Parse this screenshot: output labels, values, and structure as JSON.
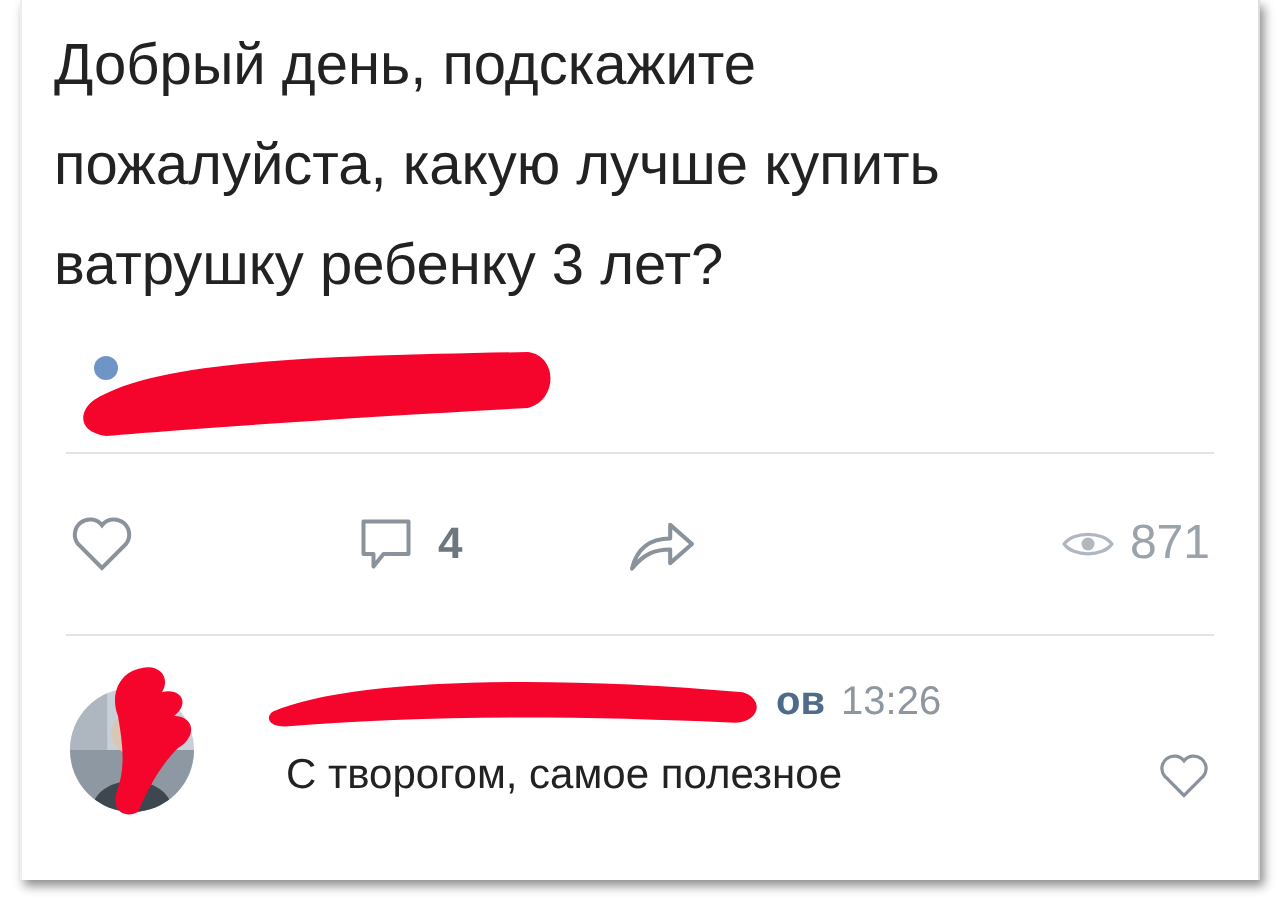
{
  "post": {
    "text": "Добрый день, подскажите пожалуйста, какую лучше купить ватрушку ребенку 3 лет?"
  },
  "actions": {
    "like": {
      "liked": false
    },
    "comments": "4",
    "views": "871"
  },
  "comment": {
    "author": "ов",
    "time": "13:26",
    "text": "С творогом, самое полезное",
    "liked": false
  }
}
